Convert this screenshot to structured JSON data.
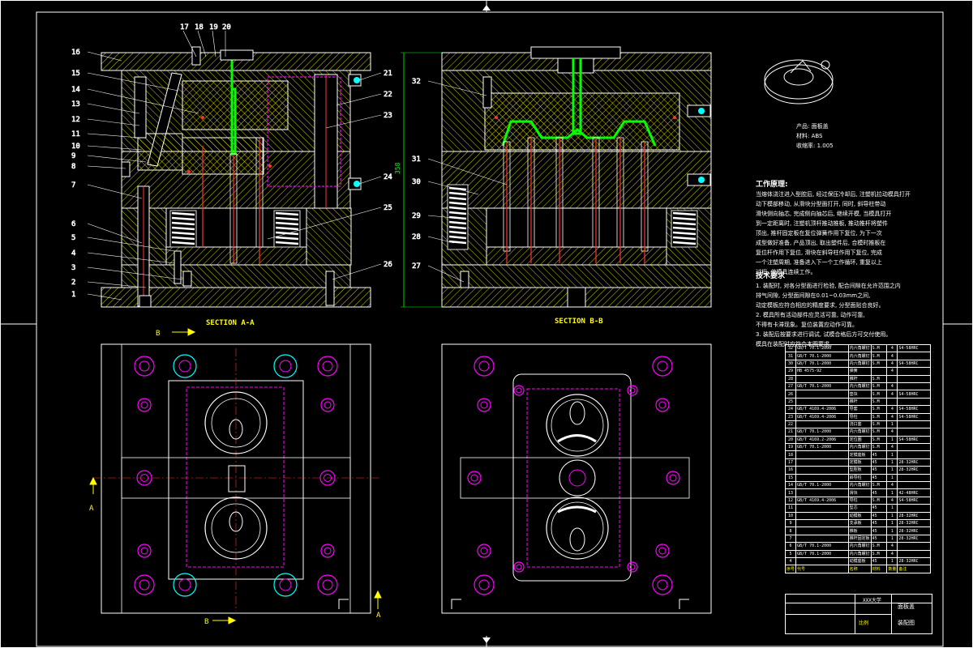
{
  "drawing": {
    "section_aa_label": "SECTION A-A",
    "section_bb_label": "SECTION B-B",
    "cut_markers": {
      "a": "A",
      "b": "B"
    },
    "dimension_height": "358",
    "callouts_left": [
      "1",
      "2",
      "3",
      "4",
      "5",
      "6",
      "7",
      "8",
      "9",
      "10",
      "11",
      "12",
      "13",
      "14",
      "15",
      "16"
    ],
    "callouts_top": [
      "17",
      "18",
      "19",
      "20"
    ],
    "callouts_right": [
      "21",
      "22",
      "23",
      "24",
      "25",
      "26"
    ],
    "callouts_bb": [
      "27",
      "28",
      "29",
      "30",
      "31",
      "32"
    ]
  },
  "product_info": {
    "name_line": "产品: 面板盖",
    "material_line": "材料: ABS",
    "shrink_line": "收缩率: 1.005"
  },
  "work_process": {
    "title": "工作原理:",
    "lines": [
      "当熔体浇注进入型腔后, 经过保压冷却后, 注塑机拉动模具打开",
      "动下模部移动, 从滑块分型面打开, 同时, 斜导柱带动",
      "滑块侧向抽芯, 完成侧向抽芯后, 继续开模, 当模具打开",
      "到一定距离时, 注塑机顶杆推动推板, 推动推杆将塑件",
      "顶出, 推杆固定板在复位弹簧作用下复位, 为下一次",
      "成型做好准备, 产品顶出, 取出塑件后, 合模时推板在",
      "复位杆作用下复位, 滑块在斜导柱作用下复位, 完成",
      "一个注塑周期, 准备进入下一个工作循环, 重复以上",
      "过程, 使模具连续工作。"
    ]
  },
  "tech_requirements": {
    "title": "技术要求",
    "lines": [
      "1. 装配时, 对各分型面进行检验, 配合间隙在允许范围之内",
      "   排气间隙, 分型面间隙在0.01~0.03mm之间,",
      "   动定模板应符合相应的精度要求, 分型面贴合良好。",
      "2. 模具所有活动部件应灵活可靠, 动作可靠,",
      "   不得有卡滞现象。复位装置应动作可靠。",
      "3. 装配后按要求进行调试, 试模合格后方可交付使用。",
      "   模具在装配时应符合本图要求。"
    ]
  },
  "bom": {
    "rows": [
      [
        "32",
        "GB/T 70.1-2000",
        "内六角螺钉",
        "S.M",
        "4",
        "S4-58HRC"
      ],
      [
        "31",
        "GB/T 70.1-2000",
        "内六角螺钉",
        "S.M",
        "4",
        ""
      ],
      [
        "30",
        "GB/T 70.1-2000",
        "内六角螺钉",
        "S.M",
        "4",
        "S4-58HRC"
      ],
      [
        "29",
        "HB 4575-92",
        "弹簧",
        "",
        "4",
        ""
      ],
      [
        "28",
        "",
        "推杆",
        "S.M",
        "",
        ""
      ],
      [
        "27",
        "GB/T 70.1-2000",
        "内六角螺钉",
        "S.M",
        "4",
        ""
      ],
      [
        "26",
        "",
        "垫块",
        "S.M",
        "4",
        "S4-58HRC"
      ],
      [
        "25",
        "",
        "推杆",
        "S.M",
        "",
        ""
      ],
      [
        "24",
        "GB/T 4169.4-2006",
        "导套",
        "S.M",
        "4",
        "S4-58HRC"
      ],
      [
        "23",
        "GB/T 4169.4-2006",
        "导柱",
        "S.M",
        "4",
        "S4-58HRC"
      ],
      [
        "22",
        "",
        "浇口套",
        "S.M",
        "1",
        ""
      ],
      [
        "21",
        "GB/T 70.1-2000",
        "内六角螺钉",
        "S.M",
        "4",
        ""
      ],
      [
        "20",
        "GB/T 4169.2-2006",
        "定位圈",
        "S.M",
        "1",
        "S4-58HRC"
      ],
      [
        "19",
        "GB/T 70.1-2000",
        "内六角螺钉",
        "S.M",
        "4",
        ""
      ],
      [
        "18",
        "",
        "定模座板",
        "45",
        "1",
        ""
      ],
      [
        "17",
        "",
        "定模板",
        "45",
        "1",
        "28-32HRC"
      ],
      [
        "16",
        "",
        "型腔板",
        "45",
        "1",
        "28-32HRC"
      ],
      [
        "15",
        "",
        "斜导柱",
        "45",
        "1",
        ""
      ],
      [
        "14",
        "GB/T 70.1-2000",
        "内六角螺钉",
        "S.M",
        "4",
        ""
      ],
      [
        "13",
        "",
        "滑块",
        "45",
        "1",
        "42-48HRC"
      ],
      [
        "12",
        "GB/T 4169.4-2006",
        "导柱",
        "S.M",
        "4",
        "S4-58HRC"
      ],
      [
        "11",
        "",
        "型芯",
        "45",
        "1",
        ""
      ],
      [
        "10",
        "",
        "动模板",
        "45",
        "1",
        "28-32HRC"
      ],
      [
        "9",
        "",
        "支承板",
        "45",
        "1",
        "28-32HRC"
      ],
      [
        "8",
        "",
        "推板",
        "45",
        "1",
        "28-32HRC"
      ],
      [
        "7",
        "",
        "推杆固定板",
        "45",
        "1",
        "28-32HRC"
      ],
      [
        "6",
        "GB/T 70.1-2000",
        "内六角螺钉",
        "S.M",
        "4",
        ""
      ],
      [
        "5",
        "GB/T 70.1-2000",
        "内六角螺钉",
        "S.M",
        "4",
        ""
      ],
      [
        "4",
        "",
        "动模座板",
        "45",
        "1",
        "28-32HRC"
      ]
    ],
    "header": [
      "序号",
      "代号",
      "名称",
      "材料",
      "数量",
      "备注"
    ],
    "title_school": "XXX大学",
    "title_drawing": "装配图",
    "title_part": "面板盖",
    "scale_note": "比例"
  },
  "colors": {
    "background": "#000000",
    "line_white": "#ffffff",
    "hatch_yellow": "#ffff00",
    "mold_magenta": "#ff00ff",
    "ejector_red": "#ff3333",
    "gate_green": "#00ff00",
    "hole_cyan": "#00ffff"
  }
}
